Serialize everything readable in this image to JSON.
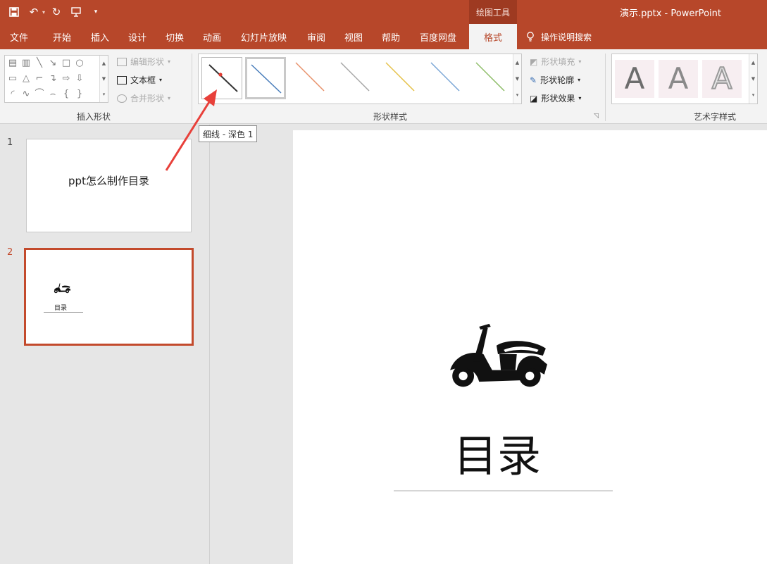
{
  "app": {
    "document_title": "演示.pptx  -  PowerPoint",
    "contextual_tab_group": "绘图工具",
    "accent_color": "#b7472a"
  },
  "quick_access": {
    "icons": [
      "save-icon",
      "undo-icon",
      "redo-icon",
      "present-icon",
      "customize-icon"
    ]
  },
  "tabs": [
    {
      "label": "文件"
    },
    {
      "label": "开始"
    },
    {
      "label": "插入"
    },
    {
      "label": "设计"
    },
    {
      "label": "切换"
    },
    {
      "label": "动画"
    },
    {
      "label": "幻灯片放映"
    },
    {
      "label": "审阅"
    },
    {
      "label": "视图"
    },
    {
      "label": "帮助"
    },
    {
      "label": "百度网盘"
    },
    {
      "label": "格式",
      "active": true
    }
  ],
  "tell_me": "操作说明搜索",
  "ribbon": {
    "insert_shapes": {
      "label": "插入形状",
      "edit_shape": "编辑形状",
      "text_box": "文本框",
      "merge_shapes": "合并形状"
    },
    "shape_styles": {
      "label": "形状样式",
      "fill": "形状填充",
      "outline": "形状轮廓",
      "effects": "形状效果",
      "line_colors": [
        "#333333",
        "#4a7ebb",
        "#e8926c",
        "#a6a6a6",
        "#e6c24a",
        "#7aa6d6",
        "#8fbe6a"
      ]
    },
    "wordart_styles": {
      "label": "艺术字样式",
      "samples": [
        "A",
        "A",
        "A"
      ]
    }
  },
  "tooltip": "细线 - 深色 1",
  "slides": [
    {
      "number": "1",
      "title": "ppt怎么制作目录"
    },
    {
      "number": "2",
      "title": "目录",
      "selected": true
    }
  ],
  "current_slide": {
    "title": "目录",
    "image": "scooter-icon"
  }
}
